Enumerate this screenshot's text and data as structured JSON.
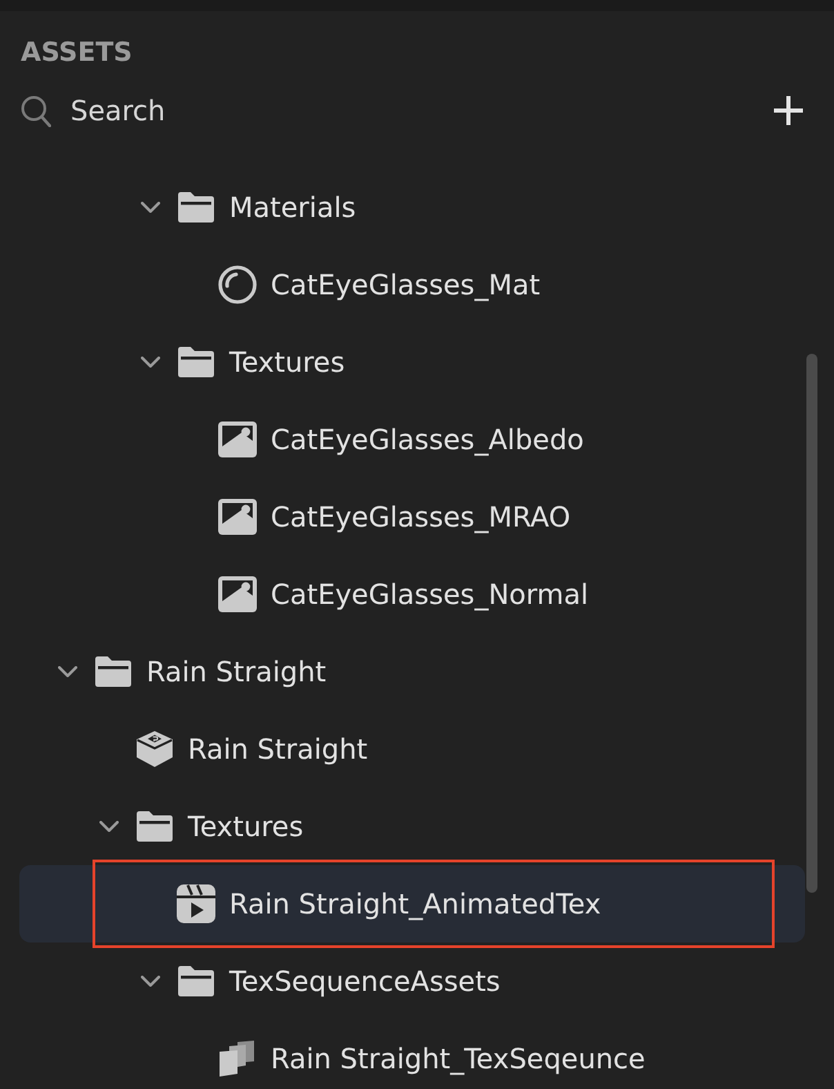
{
  "panel": {
    "title": "ASSETS"
  },
  "search": {
    "placeholder": "Search"
  },
  "tree": [
    {
      "children": [
        {
          "children": [
            {
              "kind": "folder",
              "label": "Materials",
              "expanded": true,
              "selected": false,
              "highlighted": false,
              "children": [
                {
                  "kind": "material",
                  "label": "CatEyeGlasses_Mat",
                  "selected": false,
                  "highlighted": false
                }
              ]
            },
            {
              "kind": "folder",
              "label": "Textures",
              "expanded": true,
              "selected": false,
              "highlighted": false,
              "children": [
                {
                  "kind": "texture",
                  "label": "CatEyeGlasses_Albedo",
                  "selected": false,
                  "highlighted": false
                },
                {
                  "kind": "texture",
                  "label": "CatEyeGlasses_MRAO",
                  "selected": false,
                  "highlighted": false
                },
                {
                  "kind": "texture",
                  "label": "CatEyeGlasses_Normal",
                  "selected": false,
                  "highlighted": false
                }
              ]
            }
          ]
        }
      ]
    },
    {
      "kind": "folder",
      "label": "Rain Straight",
      "expanded": true,
      "selected": false,
      "highlighted": false,
      "children": [
        {
          "kind": "prefab",
          "label": "Rain Straight",
          "selected": false,
          "highlighted": false
        },
        {
          "kind": "folder",
          "label": "Textures",
          "expanded": true,
          "selected": false,
          "highlighted": false,
          "children": [
            {
              "kind": "animated-texture",
              "label": "Rain Straight_AnimatedTex",
              "selected": true,
              "highlighted": true
            },
            {
              "kind": "folder",
              "label": "TexSequenceAssets",
              "expanded": true,
              "selected": false,
              "highlighted": false,
              "children": [
                {
                  "kind": "texture-sequence",
                  "label": "Rain Straight_TexSeqeunce",
                  "selected": false,
                  "highlighted": false
                }
              ]
            }
          ]
        }
      ]
    }
  ]
}
